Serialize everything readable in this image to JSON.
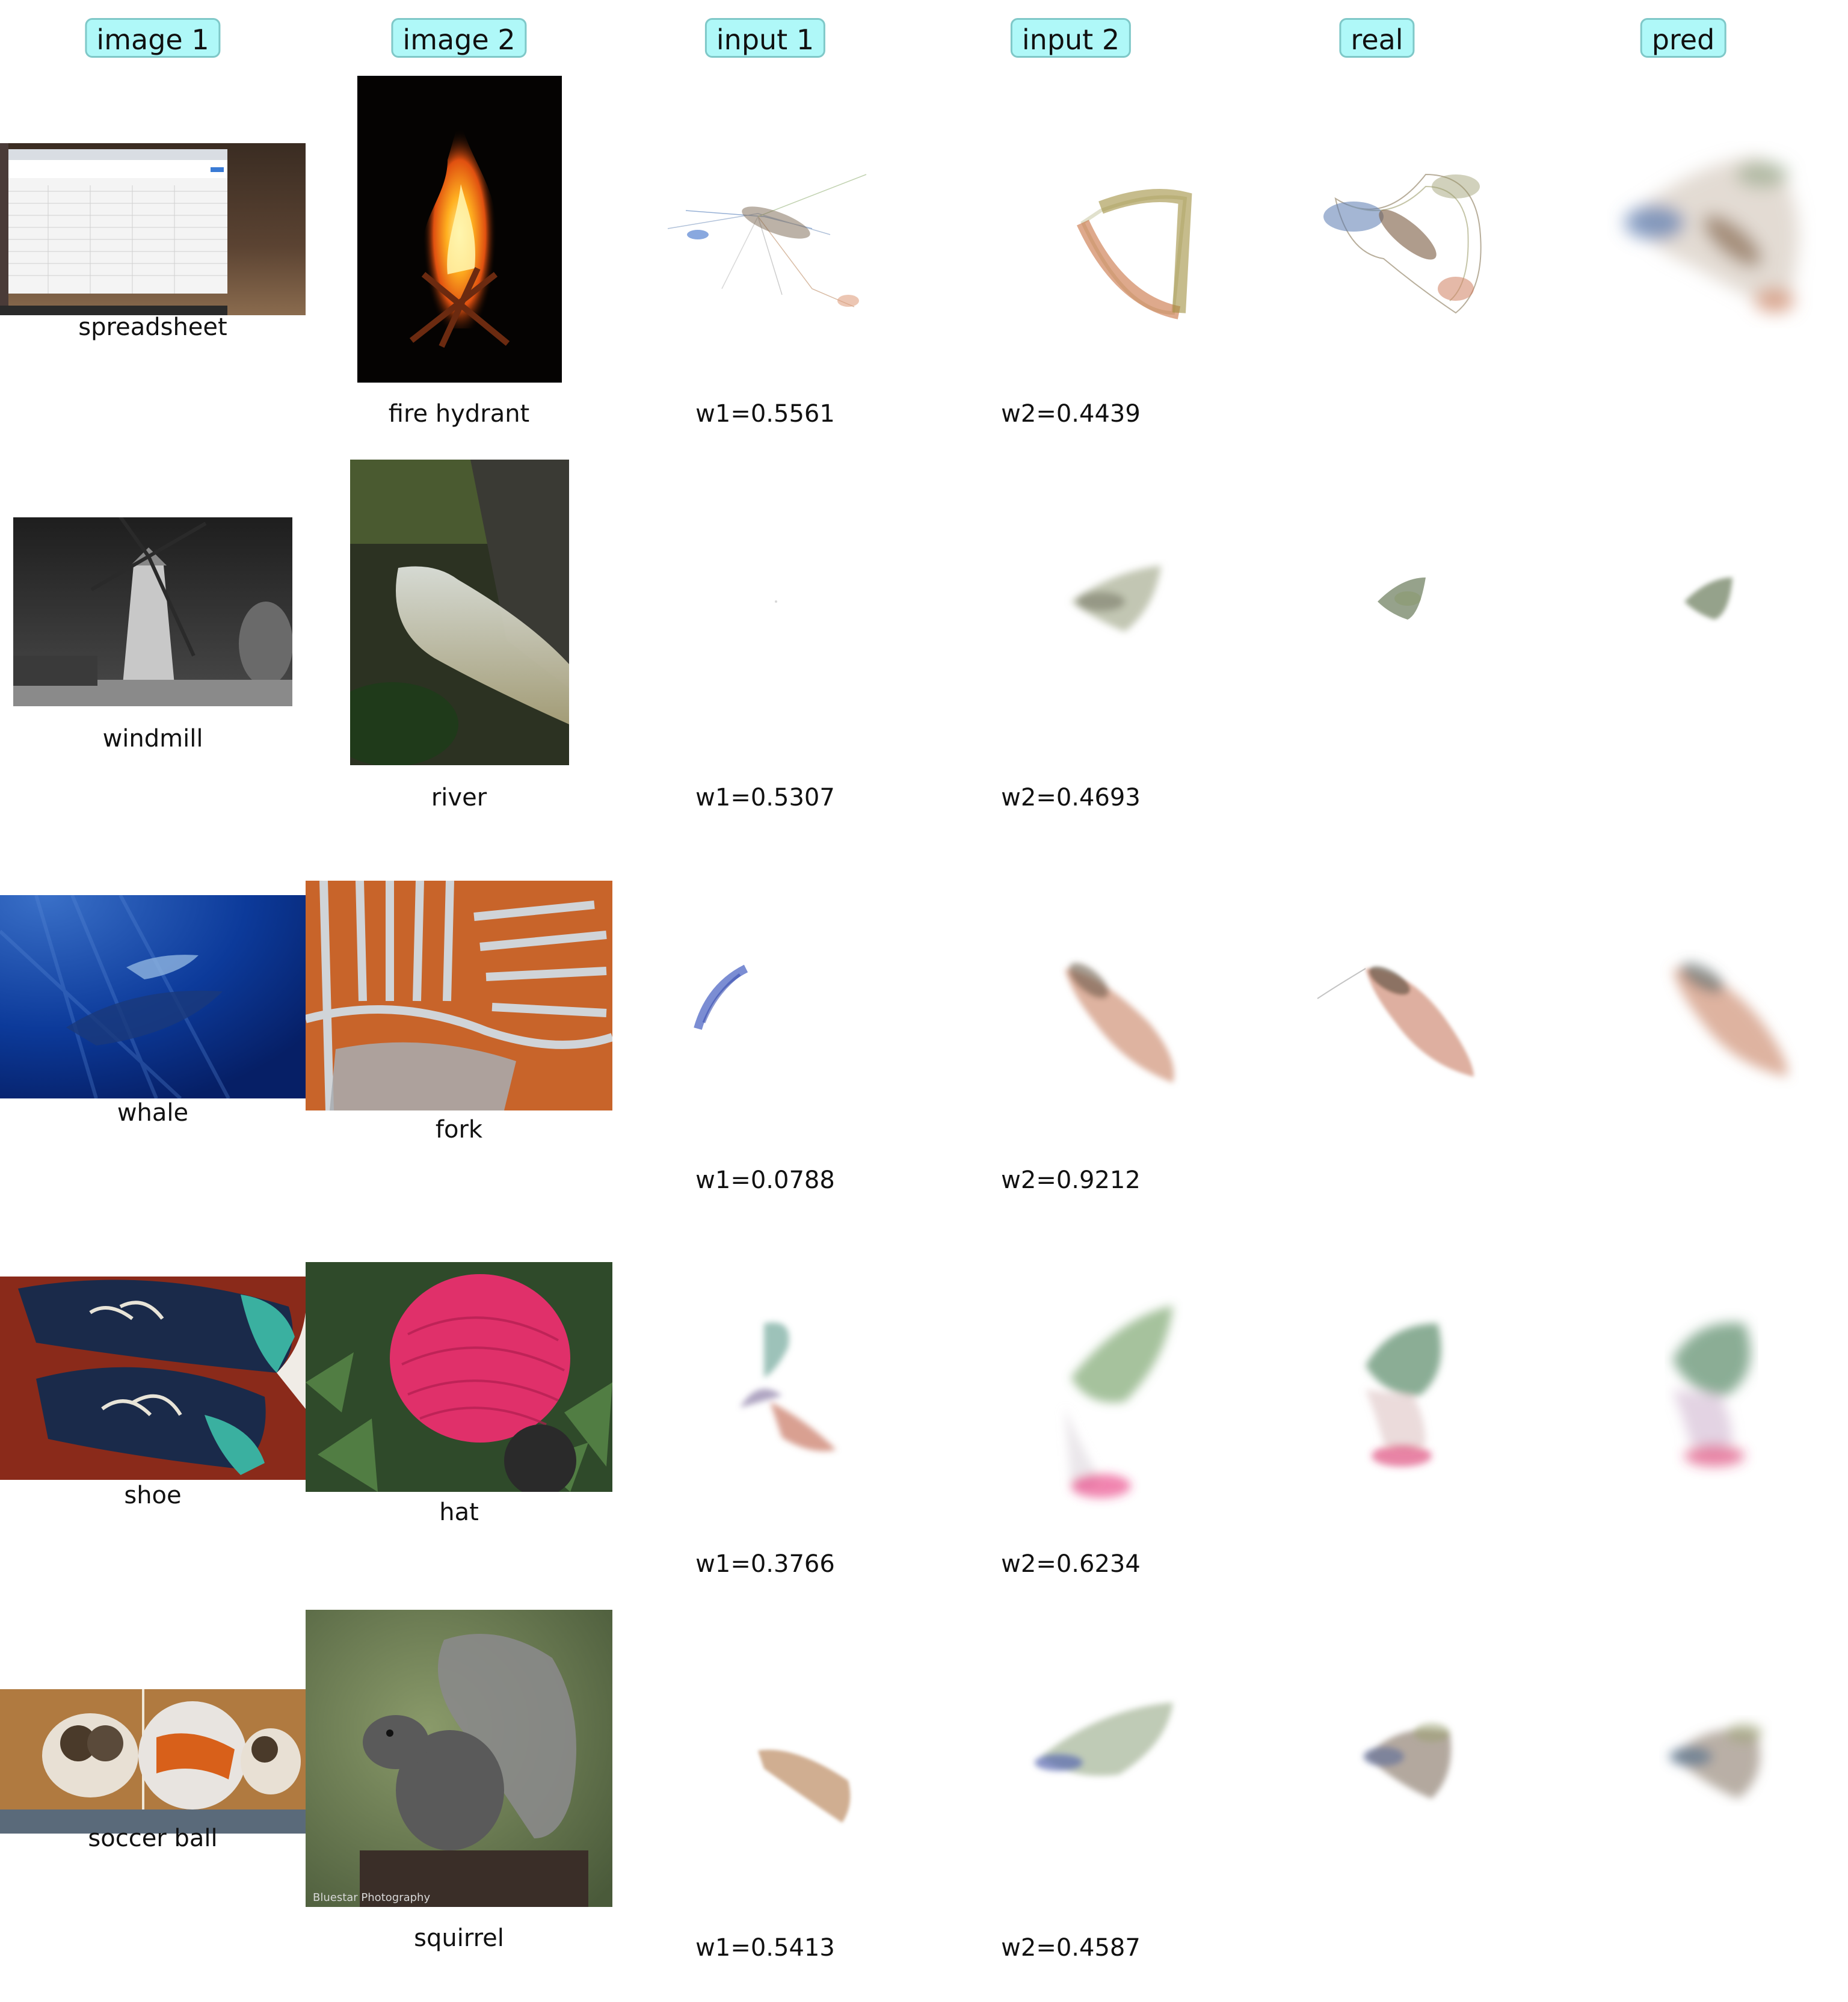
{
  "headers": [
    "image 1",
    "image 2",
    "input 1",
    "input 2",
    "real",
    "pred"
  ],
  "rows": [
    {
      "image1_label": "spreadsheet",
      "image2_label": "fire hydrant",
      "w1": "w1=0.5561",
      "w2": "w2=0.4439"
    },
    {
      "image1_label": "windmill",
      "image2_label": "river",
      "w1": "w1=0.5307",
      "w2": "w2=0.4693"
    },
    {
      "image1_label": "whale",
      "image2_label": "fork",
      "w1": "w1=0.0788",
      "w2": "w2=0.9212"
    },
    {
      "image1_label": "shoe",
      "image2_label": "hat",
      "w1": "w1=0.3766",
      "w2": "w2=0.6234"
    },
    {
      "image1_label": "soccer ball",
      "image2_label": "squirrel",
      "w1": "w1=0.5413",
      "w2": "w2=0.4587"
    }
  ],
  "watermark": "Bluestar Photography",
  "colors": {
    "header_bg": "#aff8f8",
    "header_border": "#7fc8c8"
  }
}
